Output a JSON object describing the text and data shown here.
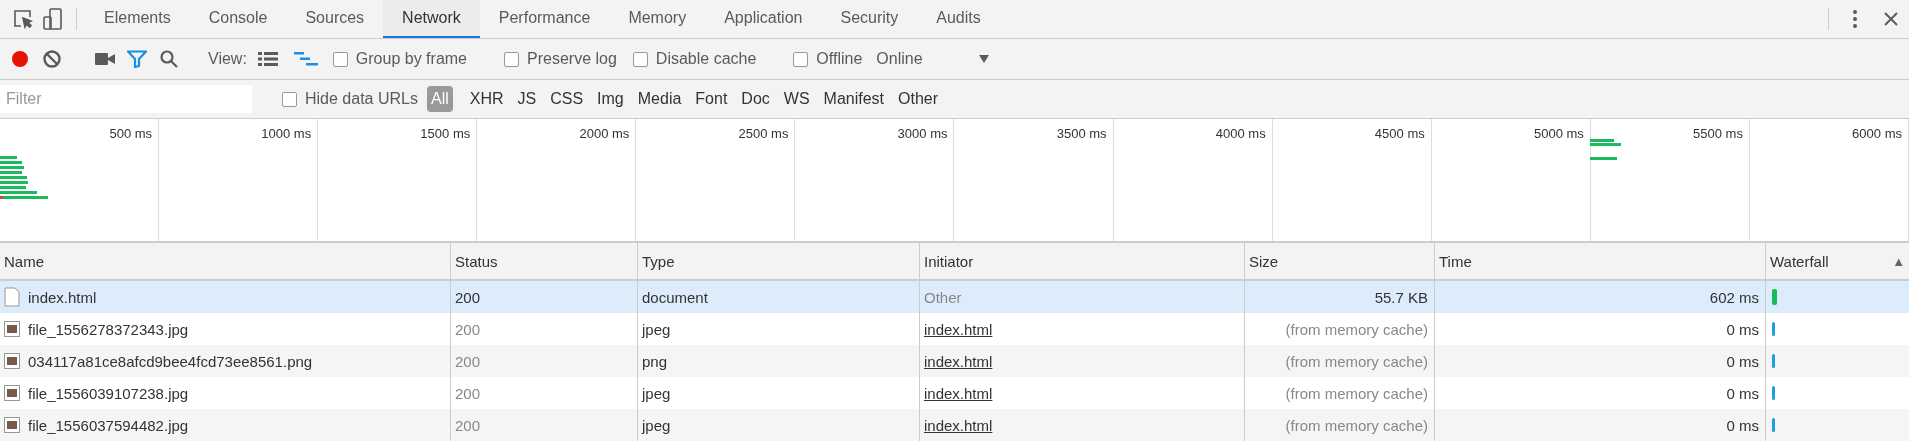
{
  "tabs": [
    {
      "label": "Elements",
      "selected": false
    },
    {
      "label": "Console",
      "selected": false
    },
    {
      "label": "Sources",
      "selected": false
    },
    {
      "label": "Network",
      "selected": true
    },
    {
      "label": "Performance",
      "selected": false
    },
    {
      "label": "Memory",
      "selected": false
    },
    {
      "label": "Application",
      "selected": false
    },
    {
      "label": "Security",
      "selected": false
    },
    {
      "label": "Audits",
      "selected": false
    }
  ],
  "toolbar": {
    "recording": true,
    "filter_active": true,
    "view_label": "View:",
    "group_by_frame": {
      "label": "Group by frame",
      "checked": false
    },
    "preserve_log": {
      "label": "Preserve log",
      "checked": false
    },
    "disable_cache": {
      "label": "Disable cache",
      "checked": false
    },
    "offline": {
      "label": "Offline",
      "checked": false
    },
    "throttling": "Online"
  },
  "filter_bar": {
    "placeholder": "Filter",
    "hide_data_urls": {
      "label": "Hide data URLs",
      "checked": false
    },
    "types": [
      {
        "label": "All",
        "selected": true
      },
      {
        "label": "XHR",
        "selected": false
      },
      {
        "label": "JS",
        "selected": false
      },
      {
        "label": "CSS",
        "selected": false
      },
      {
        "label": "Img",
        "selected": false
      },
      {
        "label": "Media",
        "selected": false
      },
      {
        "label": "Font",
        "selected": false
      },
      {
        "label": "Doc",
        "selected": false
      },
      {
        "label": "WS",
        "selected": false
      },
      {
        "label": "Manifest",
        "selected": false
      },
      {
        "label": "Other",
        "selected": false
      }
    ]
  },
  "overview": {
    "ticks": [
      "500 ms",
      "1000 ms",
      "1500 ms",
      "2000 ms",
      "2500 ms",
      "3000 ms",
      "3500 ms",
      "4000 ms",
      "4500 ms",
      "5000 ms",
      "5500 ms",
      "6000 ms"
    ]
  },
  "table": {
    "columns": [
      "Name",
      "Status",
      "Type",
      "Initiator",
      "Size",
      "Time",
      "Waterfall"
    ],
    "sort_indicator": "▲",
    "rows": [
      {
        "kind": "document",
        "name": "index.html",
        "status": "200",
        "type": "document",
        "initiator": {
          "text": "Other",
          "link": false
        },
        "size": "55.7 KB",
        "time": "602 ms",
        "from_cache": false,
        "selected": true,
        "color": "#1aba5c"
      },
      {
        "kind": "image",
        "name": "file_1556278372343.jpg",
        "status": "200",
        "type": "jpeg",
        "initiator": {
          "text": "index.html",
          "link": true
        },
        "size": "(from memory cache)",
        "time": "0 ms",
        "from_cache": true,
        "selected": false,
        "color": "#1ba1e2"
      },
      {
        "kind": "image",
        "name": "034117a81ce8afcd9bee4fcd73ee8561.png",
        "status": "200",
        "type": "png",
        "initiator": {
          "text": "index.html",
          "link": true
        },
        "size": "(from memory cache)",
        "time": "0 ms",
        "from_cache": true,
        "selected": false,
        "color": "#1ba1e2"
      },
      {
        "kind": "image",
        "name": "file_1556039107238.jpg",
        "status": "200",
        "type": "jpeg",
        "initiator": {
          "text": "index.html",
          "link": true
        },
        "size": "(from memory cache)",
        "time": "0 ms",
        "from_cache": true,
        "selected": false,
        "color": "#1ba1e2"
      },
      {
        "kind": "image",
        "name": "file_1556037594482.jpg",
        "status": "200",
        "type": "jpeg",
        "initiator": {
          "text": "index.html",
          "link": true
        },
        "size": "(from memory cache)",
        "time": "0 ms",
        "from_cache": true,
        "selected": false,
        "color": "#1ba1e2"
      }
    ]
  }
}
